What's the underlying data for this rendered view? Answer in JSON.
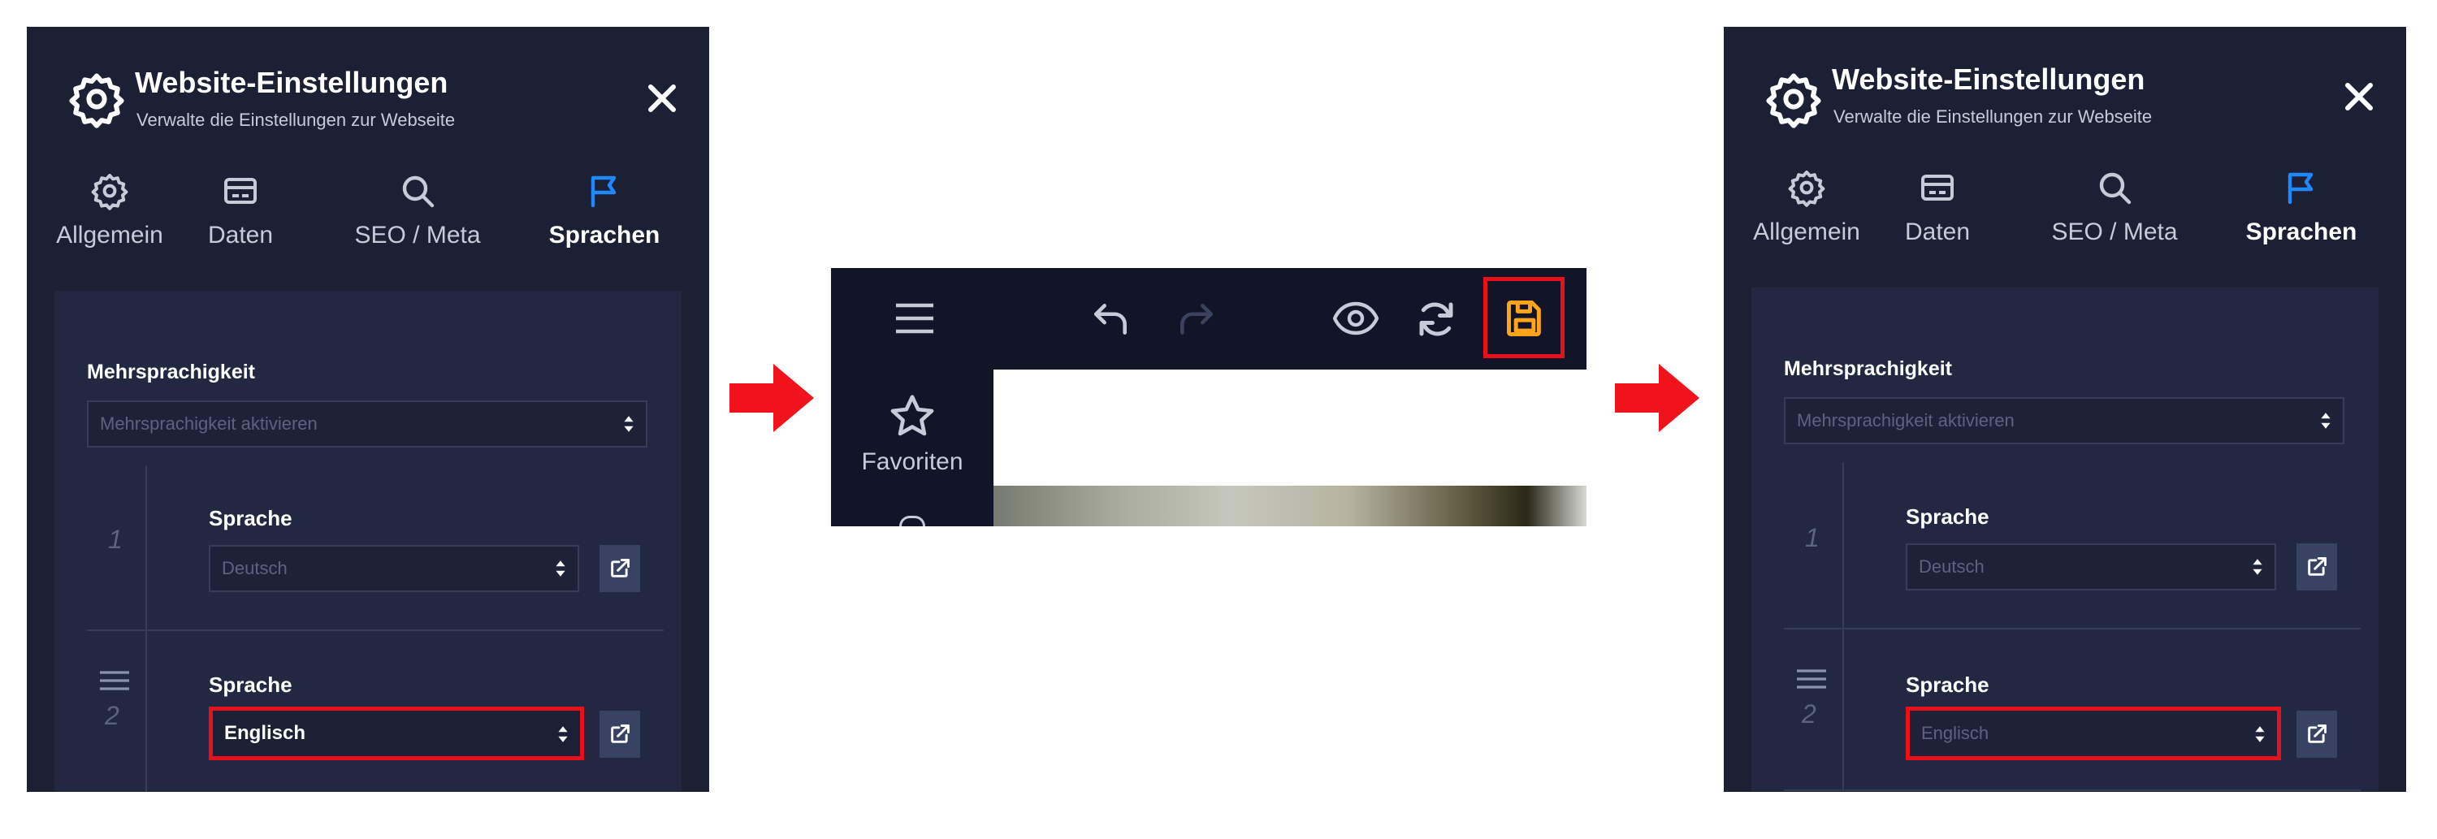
{
  "panel_left": {
    "title": "Website-Einstellungen",
    "subtitle": "Verwalte die Einstellungen zur Webseite",
    "tabs": [
      {
        "label": "Allgemein",
        "icon": "gear-icon"
      },
      {
        "label": "Daten",
        "icon": "card-icon"
      },
      {
        "label": "SEO / Meta",
        "icon": "search-icon"
      },
      {
        "label": "Sprachen",
        "icon": "flag-icon",
        "active": true
      }
    ],
    "section_label": "Mehrsprachigkeit",
    "multilang_select": "Mehrsprachigkeit aktivieren",
    "rows": [
      {
        "num": "1",
        "label": "Sprache",
        "value": "Deutsch"
      },
      {
        "num": "2",
        "label": "Sprache",
        "value": "Englisch"
      }
    ]
  },
  "panel_right": {
    "title": "Website-Einstellungen",
    "subtitle": "Verwalte die Einstellungen zur Webseite",
    "tabs": [
      {
        "label": "Allgemein",
        "icon": "gear-icon"
      },
      {
        "label": "Daten",
        "icon": "card-icon"
      },
      {
        "label": "SEO / Meta",
        "icon": "search-icon"
      },
      {
        "label": "Sprachen",
        "icon": "flag-icon",
        "active": true
      }
    ],
    "section_label": "Mehrsprachigkeit",
    "multilang_select": "Mehrsprachigkeit aktivieren",
    "rows": [
      {
        "num": "1",
        "label": "Sprache",
        "value": "Deutsch"
      },
      {
        "num": "2",
        "label": "Sprache",
        "value": "Englisch"
      }
    ]
  },
  "editor": {
    "sidebar_item": "Favoriten"
  },
  "colors": {
    "panel_bg": "#1b2034",
    "content_bg": "#222842",
    "accent_blue": "#1f87ff",
    "highlight_red": "#e8101b",
    "save_orange": "#ffa31a"
  }
}
